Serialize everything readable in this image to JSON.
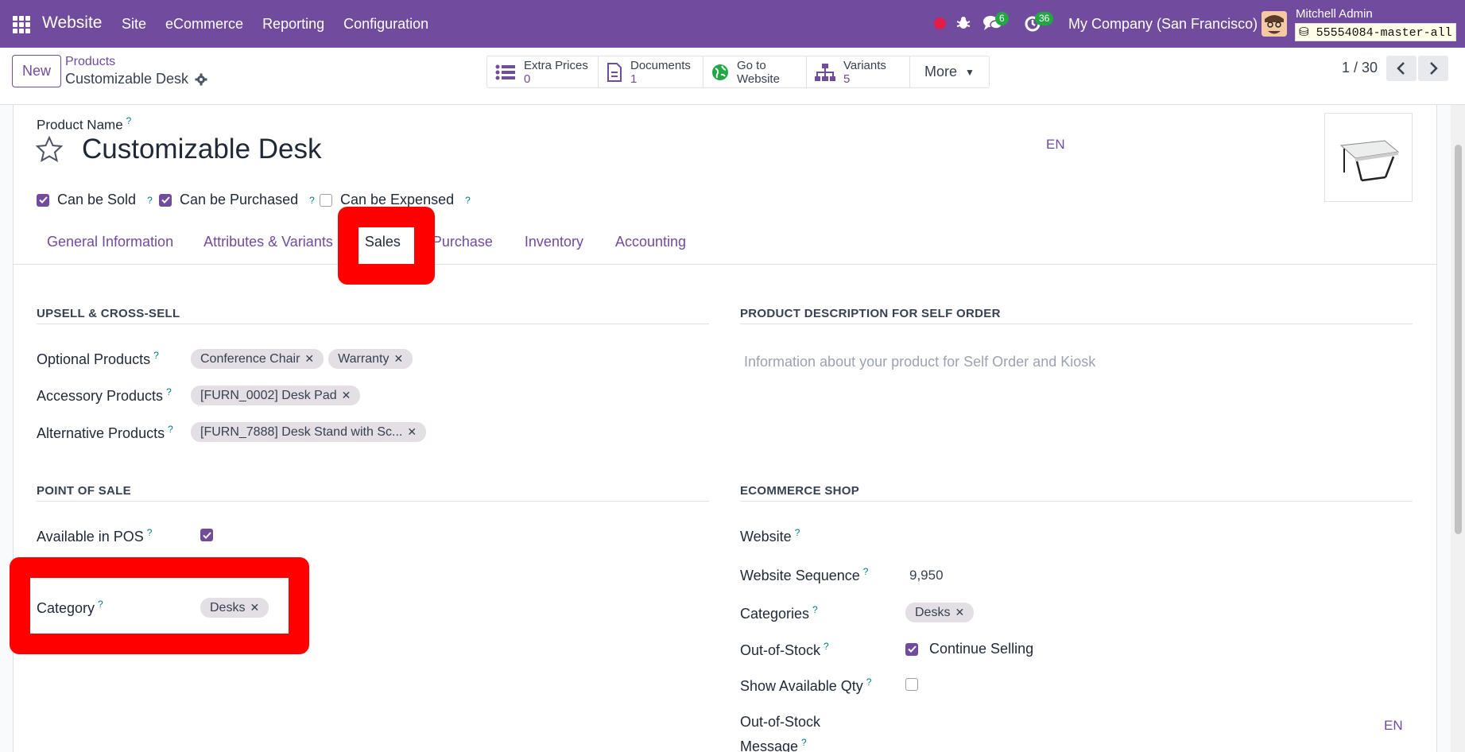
{
  "navbar": {
    "brand": "Website",
    "menu": [
      "Site",
      "eCommerce",
      "Reporting",
      "Configuration"
    ],
    "messages_count": "6",
    "activities_count": "36",
    "company": "My Company (San Francisco)",
    "user": "Mitchell Admin",
    "database": "55554084-master-all",
    "color": "#714b9e"
  },
  "control": {
    "new_label": "New",
    "breadcrumb": "Products",
    "record_title": "Customizable Desk",
    "smart_buttons": [
      {
        "label": "Extra Prices",
        "value": "0",
        "icon": "list-icon"
      },
      {
        "label": "Documents",
        "value": "1",
        "icon": "document-icon"
      },
      {
        "label": "Go to",
        "value": "Website",
        "icon": "globe-icon"
      },
      {
        "label": "Variants",
        "value": "5",
        "icon": "sitemap-icon"
      }
    ],
    "more_label": "More",
    "pager": "1 / 30"
  },
  "product": {
    "name_label": "Product Name",
    "name": "Customizable Desk",
    "lang": "EN",
    "can_be_sold": "Can be Sold",
    "can_be_purchased": "Can be Purchased",
    "can_be_expensed": "Can be Expensed"
  },
  "tabs": [
    "General Information",
    "Attributes & Variants",
    "Sales",
    "Purchase",
    "Inventory",
    "Accounting"
  ],
  "upsell": {
    "title": "UPSELL & CROSS-SELL",
    "optional_label": "Optional Products",
    "optional_tags": [
      "Conference Chair",
      "Warranty"
    ],
    "accessory_label": "Accessory Products",
    "accessory_tags": [
      "[FURN_0002] Desk Pad"
    ],
    "alternative_label": "Alternative Products",
    "alternative_tags": [
      "[FURN_7888] Desk Stand with Sc..."
    ]
  },
  "self_order": {
    "title": "PRODUCT DESCRIPTION FOR SELF ORDER",
    "placeholder": "Information about your product for Self Order and Kiosk"
  },
  "pos": {
    "title": "POINT OF SALE",
    "available_label": "Available in POS",
    "category_label": "Category",
    "category_tag": "Desks"
  },
  "ecommerce": {
    "title": "ECOMMERCE SHOP",
    "website_label": "Website",
    "sequence_label": "Website Sequence",
    "sequence_value": "9,950",
    "categories_label": "Categories",
    "categories_tag": "Desks",
    "oos_label": "Out-of-Stock",
    "oos_value": "Continue Selling",
    "show_qty_label": "Show Available Qty",
    "oos_msg_label_1": "Out-of-Stock",
    "oos_msg_label_2": "Message",
    "oos_msg_lang": "EN"
  }
}
